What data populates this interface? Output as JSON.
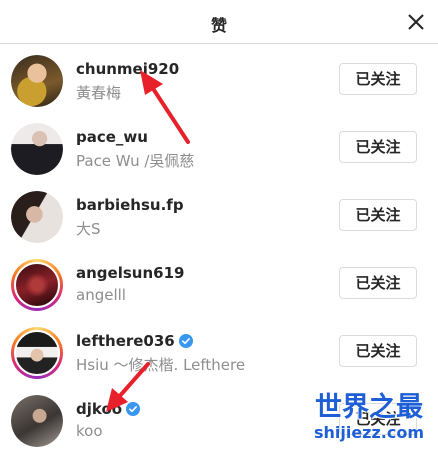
{
  "header": {
    "title": "赞"
  },
  "likes": [
    {
      "username": "chunmei920",
      "fullname": "黃春梅",
      "verified": false,
      "button": "已关注"
    },
    {
      "username": "pace_wu",
      "fullname": "Pace Wu /吳佩慈",
      "verified": false,
      "button": "已关注"
    },
    {
      "username": "barbiehsu.fp",
      "fullname": "大S",
      "verified": false,
      "button": "已关注"
    },
    {
      "username": "angelsun619",
      "fullname": "angelll",
      "verified": false,
      "button": "已关注"
    },
    {
      "username": "lefthere036",
      "fullname": "Hsiu 〜修杰楷. Lefthere",
      "verified": true,
      "button": "已关注"
    },
    {
      "username": "djkoo",
      "fullname": "koo",
      "verified": true,
      "button": "已关注"
    }
  ],
  "watermark": {
    "line1": "世界之最",
    "line2": "shijiezz.com"
  },
  "colors": {
    "verified": "#3897f0",
    "arrow": "#e8202a",
    "watermark": "#1e5fd6"
  }
}
